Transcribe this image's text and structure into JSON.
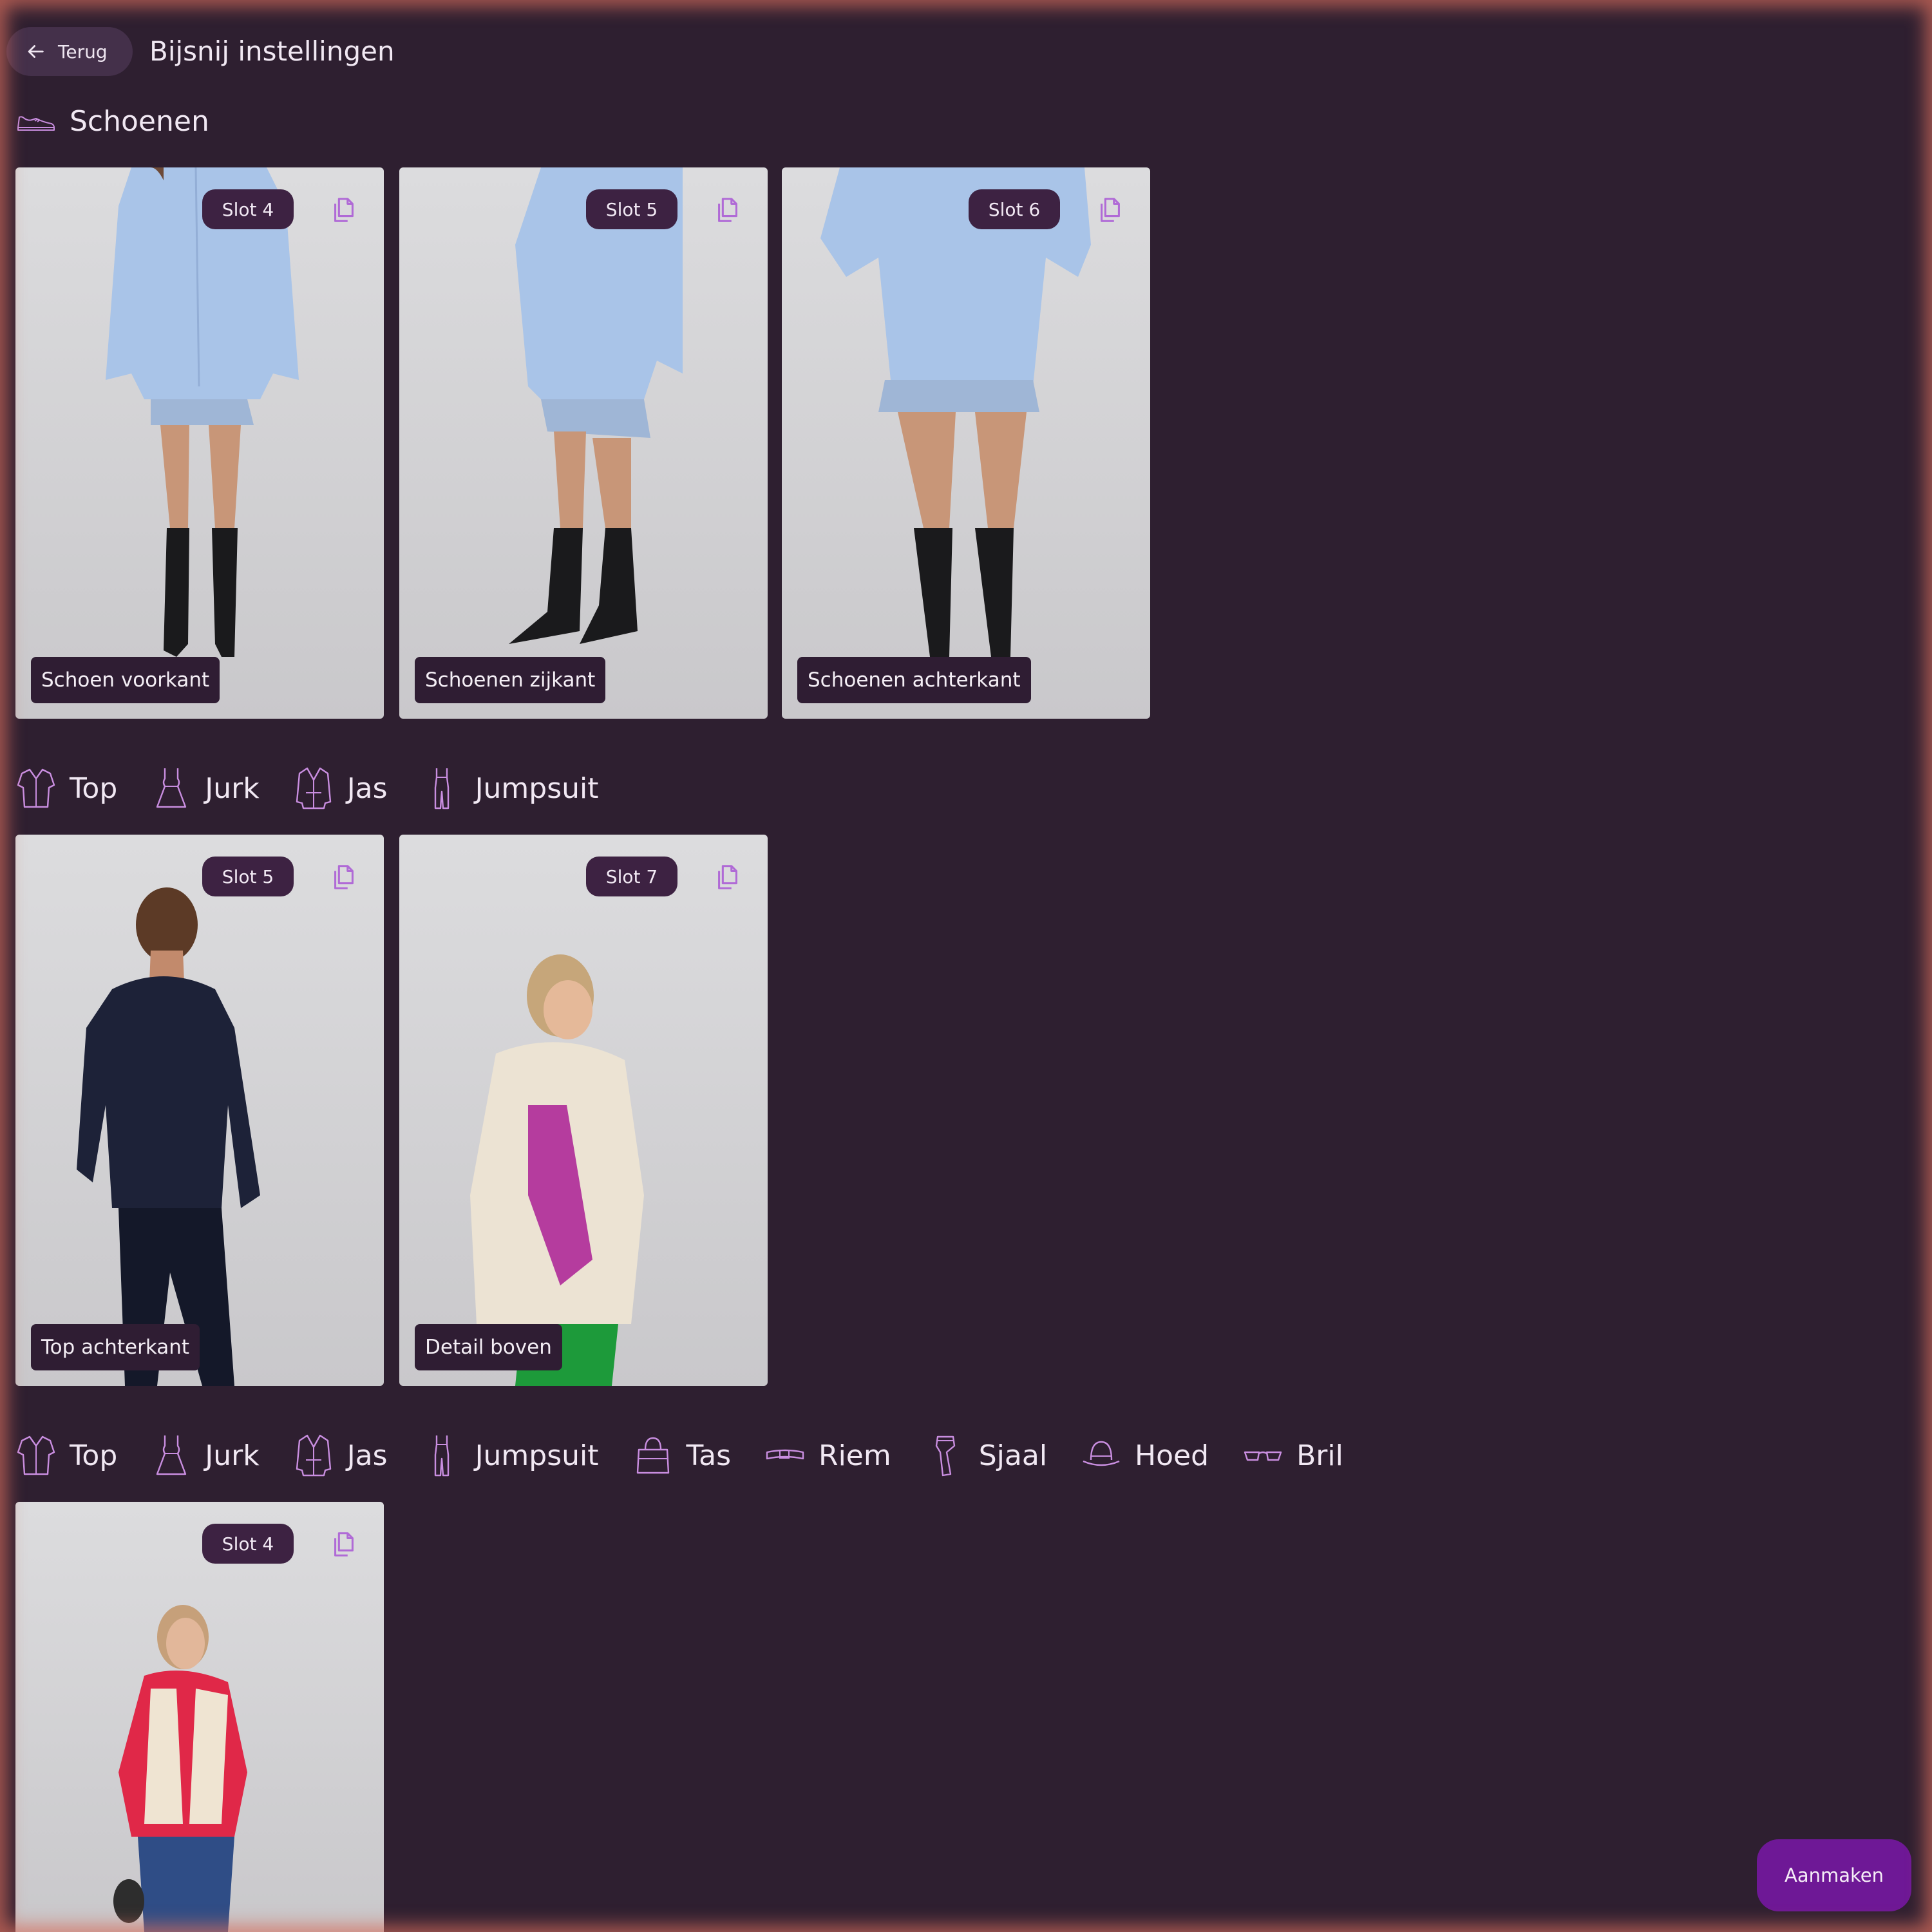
{
  "header": {
    "back_label": "Terug",
    "title": "Bijsnij instellingen"
  },
  "sections": [
    {
      "categories": [
        {
          "label": "Schoenen",
          "icon": "sneaker-icon"
        }
      ],
      "cards": [
        {
          "slot": "Slot 4",
          "label": "Schoen voorkant",
          "photo": "model-shoes-front"
        },
        {
          "slot": "Slot 5",
          "label": "Schoenen zijkant",
          "photo": "model-shoes-side"
        },
        {
          "slot": "Slot 6",
          "label": "Schoenen achterkant",
          "photo": "model-shoes-back"
        }
      ]
    },
    {
      "categories": [
        {
          "label": "Top",
          "icon": "shirt-icon"
        },
        {
          "label": "Jurk",
          "icon": "dress-icon"
        },
        {
          "label": "Jas",
          "icon": "coat-icon"
        },
        {
          "label": "Jumpsuit",
          "icon": "jumpsuit-icon"
        }
      ],
      "cards": [
        {
          "slot": "Slot 5",
          "label": "Top achterkant",
          "photo": "model-top-back"
        },
        {
          "slot": "Slot 7",
          "label": "Detail boven",
          "photo": "model-detail-top"
        }
      ]
    },
    {
      "categories": [
        {
          "label": "Top",
          "icon": "shirt-icon"
        },
        {
          "label": "Jurk",
          "icon": "dress-icon"
        },
        {
          "label": "Jas",
          "icon": "coat-icon"
        },
        {
          "label": "Jumpsuit",
          "icon": "jumpsuit-icon"
        },
        {
          "label": "Tas",
          "icon": "bag-icon"
        },
        {
          "label": "Riem",
          "icon": "belt-icon"
        },
        {
          "label": "Sjaal",
          "icon": "scarf-icon"
        },
        {
          "label": "Hoed",
          "icon": "hat-icon"
        },
        {
          "label": "Bril",
          "icon": "glasses-icon"
        }
      ],
      "cards": [
        {
          "slot": "Slot 4",
          "label": "",
          "photo": "model-vest-full"
        }
      ]
    }
  ],
  "footer": {
    "create_label": "Aanmaken"
  },
  "colors": {
    "background": "#2e1f30",
    "accent": "#6e1896",
    "icon": "#c98ee0",
    "badge": "#3d2242"
  }
}
